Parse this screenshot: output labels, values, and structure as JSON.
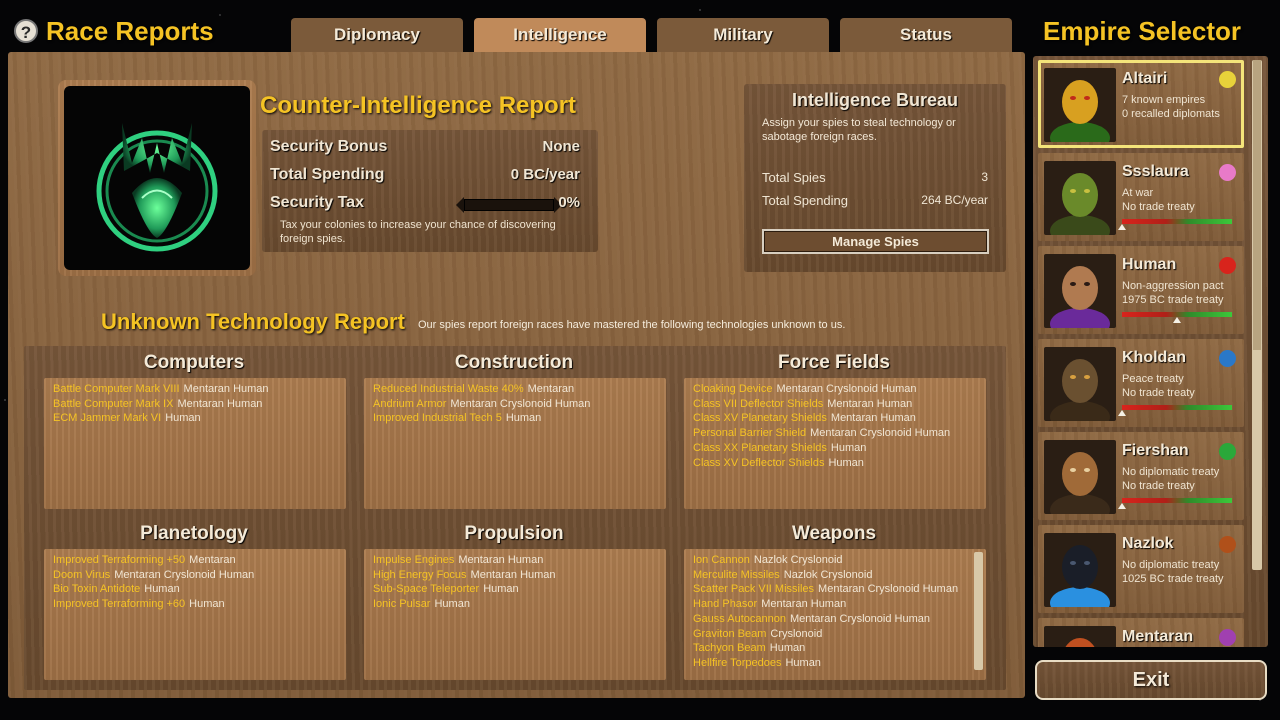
{
  "header": {
    "help_glyph": "?",
    "title": "Race Reports",
    "tabs": [
      {
        "label": "Diplomacy",
        "active": false
      },
      {
        "label": "Intelligence",
        "active": true
      },
      {
        "label": "Military",
        "active": false
      },
      {
        "label": "Status",
        "active": false
      }
    ]
  },
  "counter_intel": {
    "title": "Counter-Intelligence Report",
    "security_bonus_label": "Security Bonus",
    "security_bonus_value": "None",
    "total_spending_label": "Total Spending",
    "total_spending_value": "0 BC/year",
    "security_tax_label": "Security Tax",
    "security_tax_value": "0%",
    "security_tax_level": 0,
    "note": "Tax your colonies to increase your chance of discovering foreign spies."
  },
  "bureau": {
    "title": "Intelligence Bureau",
    "description": "Assign your spies to steal technology or sabotage foreign races.",
    "total_spies_label": "Total Spies",
    "total_spies_value": "3",
    "total_spending_label": "Total Spending",
    "total_spending_value": "264 BC/year",
    "manage_button": "Manage Spies"
  },
  "unknown_tech": {
    "title": "Unknown Technology Report",
    "subtitle": "Our spies report foreign races have mastered the following technologies unknown to us.",
    "categories": [
      {
        "name": "Computers",
        "items": [
          {
            "tech": "Battle Computer Mark VIII",
            "races": "Mentaran  Human"
          },
          {
            "tech": "Battle Computer Mark IX",
            "races": "Mentaran  Human"
          },
          {
            "tech": "ECM Jammer Mark VI",
            "races": "Human"
          }
        ]
      },
      {
        "name": "Construction",
        "items": [
          {
            "tech": "Reduced Industrial Waste 40%",
            "races": "Mentaran"
          },
          {
            "tech": "Andrium Armor",
            "races": "Mentaran  Cryslonoid  Human"
          },
          {
            "tech": "Improved Industrial Tech 5",
            "races": "Human"
          }
        ]
      },
      {
        "name": "Force Fields",
        "items": [
          {
            "tech": "Cloaking Device",
            "races": "Mentaran  Cryslonoid  Human"
          },
          {
            "tech": "Class VII Deflector Shields",
            "races": "Mentaran  Human"
          },
          {
            "tech": "Class XV Planetary Shields",
            "races": "Mentaran  Human"
          },
          {
            "tech": "Personal Barrier Shield",
            "races": "Mentaran  Cryslonoid  Human"
          },
          {
            "tech": "Class XX Planetary Shields",
            "races": "Human"
          },
          {
            "tech": "Class XV Deflector Shields",
            "races": "Human"
          }
        ]
      },
      {
        "name": "Planetology",
        "items": [
          {
            "tech": "Improved Terraforming +50",
            "races": "Mentaran"
          },
          {
            "tech": "Doom Virus",
            "races": "Mentaran  Cryslonoid  Human"
          },
          {
            "tech": "Bio Toxin Antidote",
            "races": "Human"
          },
          {
            "tech": "Improved Terraforming +60",
            "races": "Human"
          }
        ]
      },
      {
        "name": "Propulsion",
        "items": [
          {
            "tech": "Impulse Engines",
            "races": "Mentaran  Human"
          },
          {
            "tech": "High Energy Focus",
            "races": "Mentaran  Human"
          },
          {
            "tech": "Sub-Space Teleporter",
            "races": "Human"
          },
          {
            "tech": "Ionic Pulsar",
            "races": "Human"
          }
        ]
      },
      {
        "name": "Weapons",
        "items": [
          {
            "tech": "Ion Cannon",
            "races": "Nazlok  Cryslonoid"
          },
          {
            "tech": "Merculite Missiles",
            "races": "Nazlok  Cryslonoid"
          },
          {
            "tech": "Scatter Pack VII Missiles",
            "races": "Mentaran  Cryslonoid  Human"
          },
          {
            "tech": "Hand Phasor",
            "races": "Mentaran  Human"
          },
          {
            "tech": "Gauss Autocannon",
            "races": "Mentaran  Cryslonoid  Human"
          },
          {
            "tech": "Graviton Beam",
            "races": "Cryslonoid"
          },
          {
            "tech": "Tachyon Beam",
            "races": "Human"
          },
          {
            "tech": "Hellfire Torpedoes",
            "races": "Human"
          }
        ]
      }
    ]
  },
  "empire_selector": {
    "title": "Empire Selector",
    "empires": [
      {
        "name": "Altairi",
        "line1": "7 known empires",
        "line2": "0 recalled diplomats",
        "color": "#e8d23a",
        "selected": true,
        "relation": null,
        "icon": "altairi-portrait"
      },
      {
        "name": "Ssslaura",
        "line1": "At war",
        "line2": "No trade treaty",
        "color": "#e87ac8",
        "selected": false,
        "relation": 0.0,
        "icon": "ssslaura-portrait"
      },
      {
        "name": "Human",
        "line1": "Non-aggression pact",
        "line2": "1975 BC trade treaty",
        "color": "#d8241c",
        "selected": false,
        "relation": 0.5,
        "icon": "human-portrait"
      },
      {
        "name": "Kholdan",
        "line1": "Peace treaty",
        "line2": "No trade treaty",
        "color": "#2a78c8",
        "selected": false,
        "relation": 0.0,
        "icon": "kholdan-portrait"
      },
      {
        "name": "Fiershan",
        "line1": "No diplomatic treaty",
        "line2": "No trade treaty",
        "color": "#2aa83a",
        "selected": false,
        "relation": 0.0,
        "icon": "fiershan-portrait"
      },
      {
        "name": "Nazlok",
        "line1": "No diplomatic treaty",
        "line2": "1025 BC trade treaty",
        "color": "#b0501a",
        "selected": false,
        "relation": null,
        "icon": "nazlok-portrait"
      },
      {
        "name": "Mentaran",
        "line1": "",
        "line2": "",
        "color": "#a040b0",
        "selected": false,
        "relation": null,
        "icon": "mentaran-portrait"
      }
    ]
  },
  "exit_label": "Exit"
}
